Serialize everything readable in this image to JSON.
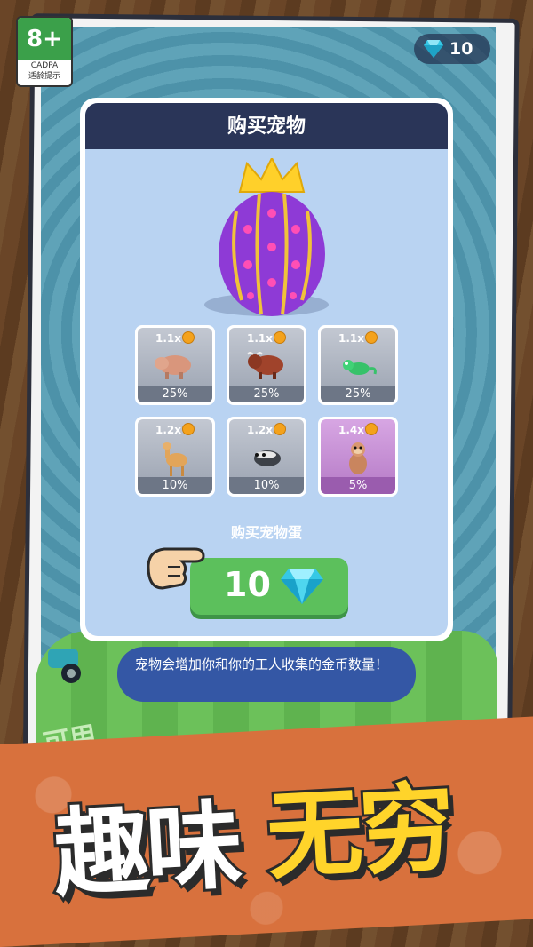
{
  "age_rating": {
    "label": "8+",
    "org": "CADPA",
    "caption": "适龄提示"
  },
  "currency": {
    "gems": "10",
    "icon": "diamond-icon",
    "color": "#36c8e6"
  },
  "dialog": {
    "title": "购买宠物",
    "pets": [
      {
        "multiplier": "1.1x",
        "chance": "25%",
        "animal": "boar",
        "rarity": "common"
      },
      {
        "multiplier": "1.1x",
        "chance": "25%",
        "animal": "bull",
        "rarity": "common"
      },
      {
        "multiplier": "1.1x",
        "chance": "25%",
        "animal": "lizard",
        "rarity": "common"
      },
      {
        "multiplier": "1.2x",
        "chance": "10%",
        "animal": "deer",
        "rarity": "uncommon"
      },
      {
        "multiplier": "1.2x",
        "chance": "10%",
        "animal": "badger",
        "rarity": "uncommon"
      },
      {
        "multiplier": "1.4x",
        "chance": "5%",
        "animal": "monkey",
        "rarity": "rare"
      }
    ],
    "buy_label": "购买宠物蛋",
    "buy_price": "10"
  },
  "info_text": "宠物会增加你和你的工人收集的金币数量！",
  "background_text": "可用",
  "banner": {
    "slogan_part1": "趣味",
    "slogan_part2": "无穷"
  },
  "colors": {
    "header": "#2a3558",
    "button": "#5cc05c",
    "egg": "#8e3ad6",
    "banner": "#d8713d",
    "slogan_accent": "#ffd42a"
  }
}
